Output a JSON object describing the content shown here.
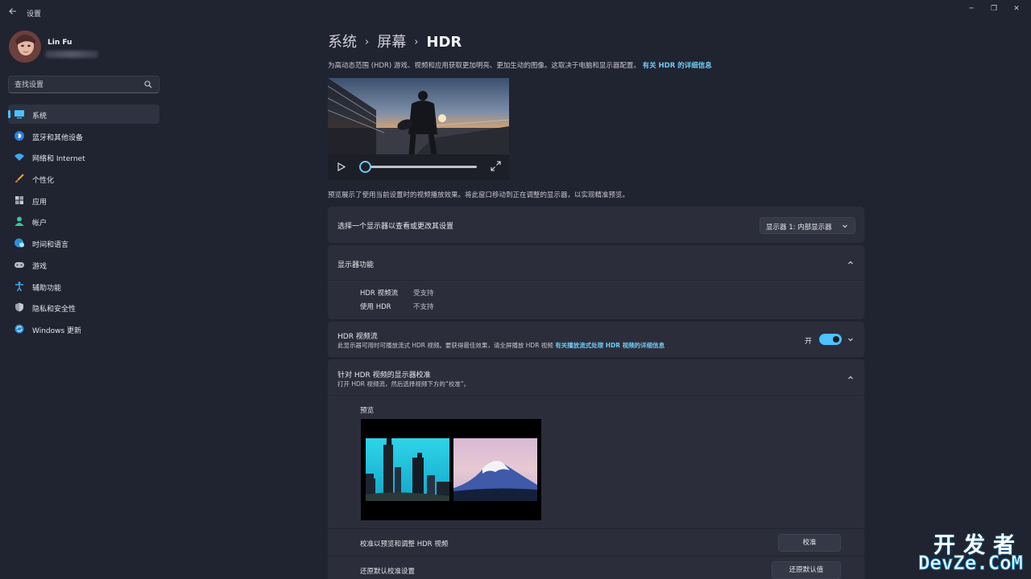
{
  "app": {
    "title": "设置"
  },
  "window_controls": {
    "minimize": "─",
    "restore": "❐",
    "close": "✕"
  },
  "user": {
    "name": "Lin Fu"
  },
  "search": {
    "placeholder": "查找设置"
  },
  "sidebar": {
    "items": [
      {
        "label": "系统",
        "icon": "monitor-icon",
        "active": true
      },
      {
        "label": "蓝牙和其他设备",
        "icon": "bluetooth-icon"
      },
      {
        "label": "网络和 Internet",
        "icon": "wifi-icon"
      },
      {
        "label": "个性化",
        "icon": "brush-icon"
      },
      {
        "label": "应用",
        "icon": "apps-icon"
      },
      {
        "label": "帐户",
        "icon": "person-icon"
      },
      {
        "label": "时间和语言",
        "icon": "globe-clock-icon"
      },
      {
        "label": "游戏",
        "icon": "gamepad-icon"
      },
      {
        "label": "辅助功能",
        "icon": "accessibility-icon"
      },
      {
        "label": "隐私和安全性",
        "icon": "shield-icon"
      },
      {
        "label": "Windows 更新",
        "icon": "update-icon"
      }
    ]
  },
  "breadcrumb": {
    "part1": "系统",
    "part2": "屏幕",
    "current": "HDR",
    "separator": "›"
  },
  "intro": {
    "text": "为高动态范围 (HDR) 游戏、视频和应用获取更加明亮、更加生动的图像。这取决于电脑和显示器配置。",
    "link": "有关 HDR 的详细信息"
  },
  "video": {
    "progress": 0.0
  },
  "preview_note": "预览展示了使用当前设置时的视频播放效果。将此窗口移动到正在调整的显示器，以实现精准预览。",
  "display_select": {
    "label": "选择一个显示器以查看或更改其设置",
    "value": "显示器 1: 内部显示器"
  },
  "capabilities": {
    "title": "显示器功能",
    "rows": [
      {
        "key": "HDR 视频流",
        "value": "受支持"
      },
      {
        "key": "使用 HDR",
        "value": "不支持"
      }
    ]
  },
  "hdr_stream": {
    "title": "HDR 视频流",
    "desc": "此显示器可用时可播放流式 HDR 视频。要获得最佳效果，请全屏播放 HDR 视频",
    "link": "有关播放流式处理 HDR 视频的详细信息",
    "toggle_label": "开",
    "toggle_on": true
  },
  "calibration": {
    "title": "针对 HDR 视频的显示器校准",
    "desc": "打开 HDR 视频流，然后选择视频下方的“校准”。",
    "preview_label": "预览",
    "calibrate_label": "校准以预览和调整 HDR 视频",
    "calibrate_button": "校准",
    "reset_label": "还原默认校准设置",
    "reset_button": "还原默认值"
  },
  "watermark": {
    "line1": "开发者",
    "line2": "DevZe.CoM"
  },
  "colors": {
    "accent": "#4cc2ff",
    "link": "#6fc9f4",
    "background": "#202330",
    "card": "#2b2e3a"
  }
}
